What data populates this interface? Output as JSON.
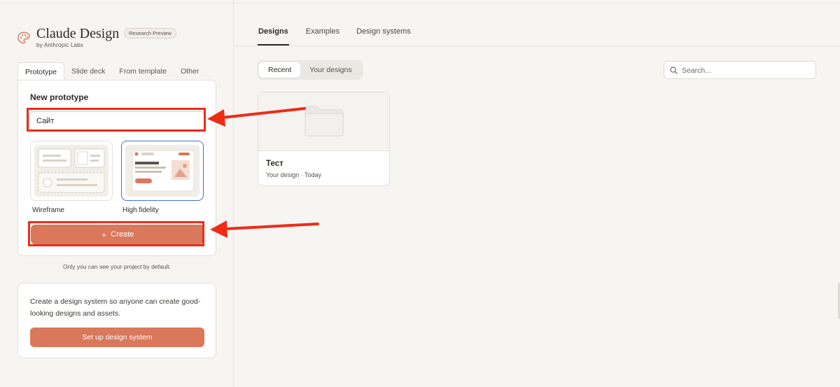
{
  "brand": {
    "title": "Claude Design",
    "subtitle": "by Anthropic Labs",
    "badge": "Research Preview"
  },
  "sidebar": {
    "tabs": [
      {
        "label": "Prototype",
        "active": true
      },
      {
        "label": "Slide deck"
      },
      {
        "label": "From template"
      },
      {
        "label": "Other"
      }
    ],
    "prototype": {
      "title": "New prototype",
      "name_value": "Сайт",
      "options": [
        {
          "label": "Wireframe",
          "selected": false
        },
        {
          "label": "High fidelity",
          "selected": true
        }
      ],
      "create_label": "Create",
      "privacy_note": "Only you can see your project by default."
    },
    "design_system": {
      "text": "Create a design system so anyone can create good-looking designs and assets.",
      "button_label": "Set up design system"
    }
  },
  "main": {
    "tabs": [
      {
        "label": "Designs",
        "active": true
      },
      {
        "label": "Examples"
      },
      {
        "label": "Design systems"
      }
    ],
    "filter": [
      {
        "label": "Recent",
        "active": true
      },
      {
        "label": "Your designs"
      }
    ],
    "search_placeholder": "Search...",
    "designs": [
      {
        "title": "Тест",
        "meta": "Your design · Today"
      }
    ]
  },
  "colors": {
    "accent": "#d9785a",
    "annotation": "#ef2b16",
    "selected_border": "#3d76c8",
    "background": "#f7f5f2"
  },
  "icons": [
    "palette-icon",
    "plus-icon",
    "search-icon",
    "folder-icon"
  ]
}
